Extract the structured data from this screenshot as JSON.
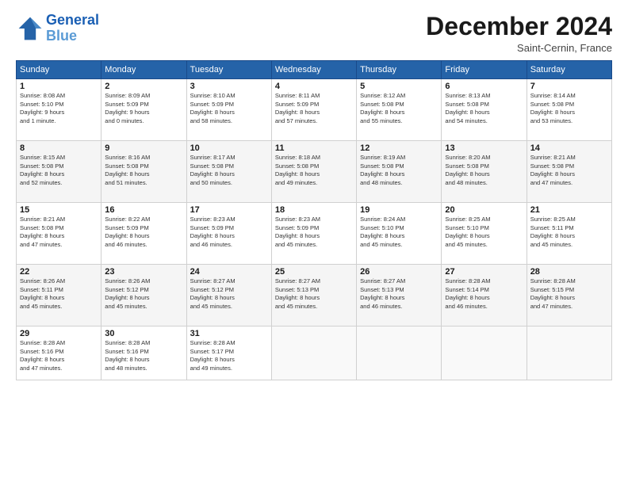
{
  "header": {
    "logo_line1": "General",
    "logo_line2": "Blue",
    "month_title": "December 2024",
    "subtitle": "Saint-Cernin, France"
  },
  "weekdays": [
    "Sunday",
    "Monday",
    "Tuesday",
    "Wednesday",
    "Thursday",
    "Friday",
    "Saturday"
  ],
  "weeks": [
    [
      {
        "day": "1",
        "info": "Sunrise: 8:08 AM\nSunset: 5:10 PM\nDaylight: 9 hours\nand 1 minute."
      },
      {
        "day": "2",
        "info": "Sunrise: 8:09 AM\nSunset: 5:09 PM\nDaylight: 9 hours\nand 0 minutes."
      },
      {
        "day": "3",
        "info": "Sunrise: 8:10 AM\nSunset: 5:09 PM\nDaylight: 8 hours\nand 58 minutes."
      },
      {
        "day": "4",
        "info": "Sunrise: 8:11 AM\nSunset: 5:09 PM\nDaylight: 8 hours\nand 57 minutes."
      },
      {
        "day": "5",
        "info": "Sunrise: 8:12 AM\nSunset: 5:08 PM\nDaylight: 8 hours\nand 55 minutes."
      },
      {
        "day": "6",
        "info": "Sunrise: 8:13 AM\nSunset: 5:08 PM\nDaylight: 8 hours\nand 54 minutes."
      },
      {
        "day": "7",
        "info": "Sunrise: 8:14 AM\nSunset: 5:08 PM\nDaylight: 8 hours\nand 53 minutes."
      }
    ],
    [
      {
        "day": "8",
        "info": "Sunrise: 8:15 AM\nSunset: 5:08 PM\nDaylight: 8 hours\nand 52 minutes."
      },
      {
        "day": "9",
        "info": "Sunrise: 8:16 AM\nSunset: 5:08 PM\nDaylight: 8 hours\nand 51 minutes."
      },
      {
        "day": "10",
        "info": "Sunrise: 8:17 AM\nSunset: 5:08 PM\nDaylight: 8 hours\nand 50 minutes."
      },
      {
        "day": "11",
        "info": "Sunrise: 8:18 AM\nSunset: 5:08 PM\nDaylight: 8 hours\nand 49 minutes."
      },
      {
        "day": "12",
        "info": "Sunrise: 8:19 AM\nSunset: 5:08 PM\nDaylight: 8 hours\nand 48 minutes."
      },
      {
        "day": "13",
        "info": "Sunrise: 8:20 AM\nSunset: 5:08 PM\nDaylight: 8 hours\nand 48 minutes."
      },
      {
        "day": "14",
        "info": "Sunrise: 8:21 AM\nSunset: 5:08 PM\nDaylight: 8 hours\nand 47 minutes."
      }
    ],
    [
      {
        "day": "15",
        "info": "Sunrise: 8:21 AM\nSunset: 5:08 PM\nDaylight: 8 hours\nand 47 minutes."
      },
      {
        "day": "16",
        "info": "Sunrise: 8:22 AM\nSunset: 5:09 PM\nDaylight: 8 hours\nand 46 minutes."
      },
      {
        "day": "17",
        "info": "Sunrise: 8:23 AM\nSunset: 5:09 PM\nDaylight: 8 hours\nand 46 minutes."
      },
      {
        "day": "18",
        "info": "Sunrise: 8:23 AM\nSunset: 5:09 PM\nDaylight: 8 hours\nand 45 minutes."
      },
      {
        "day": "19",
        "info": "Sunrise: 8:24 AM\nSunset: 5:10 PM\nDaylight: 8 hours\nand 45 minutes."
      },
      {
        "day": "20",
        "info": "Sunrise: 8:25 AM\nSunset: 5:10 PM\nDaylight: 8 hours\nand 45 minutes."
      },
      {
        "day": "21",
        "info": "Sunrise: 8:25 AM\nSunset: 5:11 PM\nDaylight: 8 hours\nand 45 minutes."
      }
    ],
    [
      {
        "day": "22",
        "info": "Sunrise: 8:26 AM\nSunset: 5:11 PM\nDaylight: 8 hours\nand 45 minutes."
      },
      {
        "day": "23",
        "info": "Sunrise: 8:26 AM\nSunset: 5:12 PM\nDaylight: 8 hours\nand 45 minutes."
      },
      {
        "day": "24",
        "info": "Sunrise: 8:27 AM\nSunset: 5:12 PM\nDaylight: 8 hours\nand 45 minutes."
      },
      {
        "day": "25",
        "info": "Sunrise: 8:27 AM\nSunset: 5:13 PM\nDaylight: 8 hours\nand 45 minutes."
      },
      {
        "day": "26",
        "info": "Sunrise: 8:27 AM\nSunset: 5:13 PM\nDaylight: 8 hours\nand 46 minutes."
      },
      {
        "day": "27",
        "info": "Sunrise: 8:28 AM\nSunset: 5:14 PM\nDaylight: 8 hours\nand 46 minutes."
      },
      {
        "day": "28",
        "info": "Sunrise: 8:28 AM\nSunset: 5:15 PM\nDaylight: 8 hours\nand 47 minutes."
      }
    ],
    [
      {
        "day": "29",
        "info": "Sunrise: 8:28 AM\nSunset: 5:16 PM\nDaylight: 8 hours\nand 47 minutes."
      },
      {
        "day": "30",
        "info": "Sunrise: 8:28 AM\nSunset: 5:16 PM\nDaylight: 8 hours\nand 48 minutes."
      },
      {
        "day": "31",
        "info": "Sunrise: 8:28 AM\nSunset: 5:17 PM\nDaylight: 8 hours\nand 49 minutes."
      },
      {
        "day": "",
        "info": ""
      },
      {
        "day": "",
        "info": ""
      },
      {
        "day": "",
        "info": ""
      },
      {
        "day": "",
        "info": ""
      }
    ]
  ]
}
